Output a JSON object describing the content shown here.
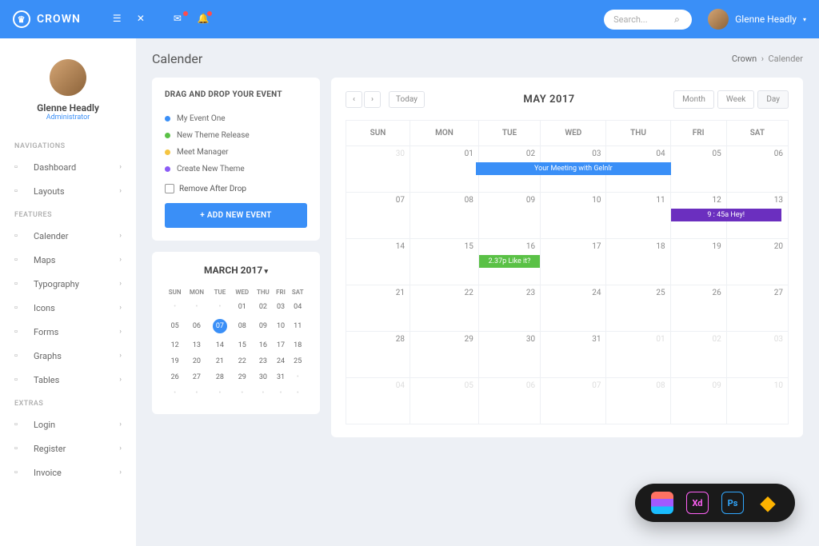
{
  "app": {
    "name": "CROWN"
  },
  "topbar": {
    "search_placeholder": "Search...",
    "user_name": "Glenne Headly"
  },
  "profile": {
    "name": "Glenne Headly",
    "role": "Administrator"
  },
  "sidebar": {
    "sections": [
      {
        "label": "NAVIGATIONS",
        "items": [
          {
            "label": "Dashboard",
            "icon": "dashboard"
          },
          {
            "label": "Layouts",
            "icon": "layouts"
          }
        ]
      },
      {
        "label": "FEATURES",
        "items": [
          {
            "label": "Calender",
            "icon": "calendar"
          },
          {
            "label": "Maps",
            "icon": "map"
          },
          {
            "label": "Typography",
            "icon": "typography"
          },
          {
            "label": "Icons",
            "icon": "icons"
          },
          {
            "label": "Forms",
            "icon": "form"
          },
          {
            "label": "Graphs",
            "icon": "graph"
          },
          {
            "label": "Tables",
            "icon": "table"
          }
        ]
      },
      {
        "label": "EXTRAS",
        "items": [
          {
            "label": "Login",
            "icon": "login"
          },
          {
            "label": "Register",
            "icon": "register"
          },
          {
            "label": "Invoice",
            "icon": "invoice"
          }
        ]
      }
    ]
  },
  "page": {
    "title": "Calender"
  },
  "breadcrumb": {
    "root": "Crown",
    "sep": "›",
    "current": "Calender"
  },
  "events_panel": {
    "title": "DRAG AND DROP YOUR EVENT",
    "items": [
      {
        "label": "My Event One",
        "color": "blue"
      },
      {
        "label": "New Theme Release",
        "color": "green"
      },
      {
        "label": "Meet Manager",
        "color": "yellow"
      },
      {
        "label": "Create New Theme",
        "color": "purple"
      }
    ],
    "remove_checkbox": "Remove After Drop",
    "add_button": "+  ADD NEW EVENT"
  },
  "mini_calendar": {
    "title": "MARCH 2017",
    "dow": [
      "SUN",
      "MON",
      "TUE",
      "WED",
      "THU",
      "FRI",
      "SAT"
    ],
    "weeks": [
      [
        "",
        "",
        "",
        "01",
        "02",
        "03",
        "04"
      ],
      [
        "05",
        "06",
        "07",
        "08",
        "09",
        "10",
        "11"
      ],
      [
        "12",
        "13",
        "14",
        "15",
        "16",
        "17",
        "18"
      ],
      [
        "19",
        "20",
        "21",
        "22",
        "23",
        "24",
        "25"
      ],
      [
        "26",
        "27",
        "28",
        "29",
        "30",
        "31",
        ""
      ],
      [
        "",
        "",
        "",
        "",
        "",
        "",
        ""
      ]
    ],
    "today": "07"
  },
  "calendar": {
    "today_btn": "Today",
    "title": "MAY 2017",
    "views": [
      "Month",
      "Week",
      "Day"
    ],
    "active_view": "Day",
    "dow": [
      "SUN",
      "MON",
      "TUE",
      "WED",
      "THU",
      "FRI",
      "SAT"
    ],
    "weeks": [
      [
        {
          "d": "30",
          "m": true
        },
        {
          "d": "01"
        },
        {
          "d": "02"
        },
        {
          "d": "03",
          "evt": {
            "text": "Your Meeting with Gelnlr",
            "cls": "evt-blue",
            "span": 3,
            "start": -1
          }
        },
        {
          "d": "04"
        },
        {
          "d": "05"
        },
        {
          "d": "06"
        }
      ],
      [
        {
          "d": "07"
        },
        {
          "d": "08"
        },
        {
          "d": "09"
        },
        {
          "d": "10"
        },
        {
          "d": "11"
        },
        {
          "d": "12",
          "evt": {
            "text": "9 : 45a Hey!",
            "cls": "evt-purple",
            "span": 2
          }
        },
        {
          "d": "13"
        }
      ],
      [
        {
          "d": "14"
        },
        {
          "d": "15"
        },
        {
          "d": "16",
          "evt": {
            "text": "2.37p Like it?",
            "cls": "evt-green",
            "span": 1
          }
        },
        {
          "d": "17"
        },
        {
          "d": "18"
        },
        {
          "d": "19"
        },
        {
          "d": "20"
        }
      ],
      [
        {
          "d": "21"
        },
        {
          "d": "22"
        },
        {
          "d": "23"
        },
        {
          "d": "24"
        },
        {
          "d": "25"
        },
        {
          "d": "26"
        },
        {
          "d": "27"
        }
      ],
      [
        {
          "d": "28"
        },
        {
          "d": "29"
        },
        {
          "d": "30"
        },
        {
          "d": "31"
        },
        {
          "d": "01",
          "m": true
        },
        {
          "d": "02",
          "m": true
        },
        {
          "d": "03",
          "m": true
        }
      ],
      [
        {
          "d": "04",
          "m": true
        },
        {
          "d": "05",
          "m": true
        },
        {
          "d": "06",
          "m": true
        },
        {
          "d": "07",
          "m": true
        },
        {
          "d": "08",
          "m": true
        },
        {
          "d": "09",
          "m": true
        },
        {
          "d": "10",
          "m": true
        }
      ]
    ]
  },
  "tools": [
    "Figma",
    "Xd",
    "Ps",
    "Sketch"
  ]
}
